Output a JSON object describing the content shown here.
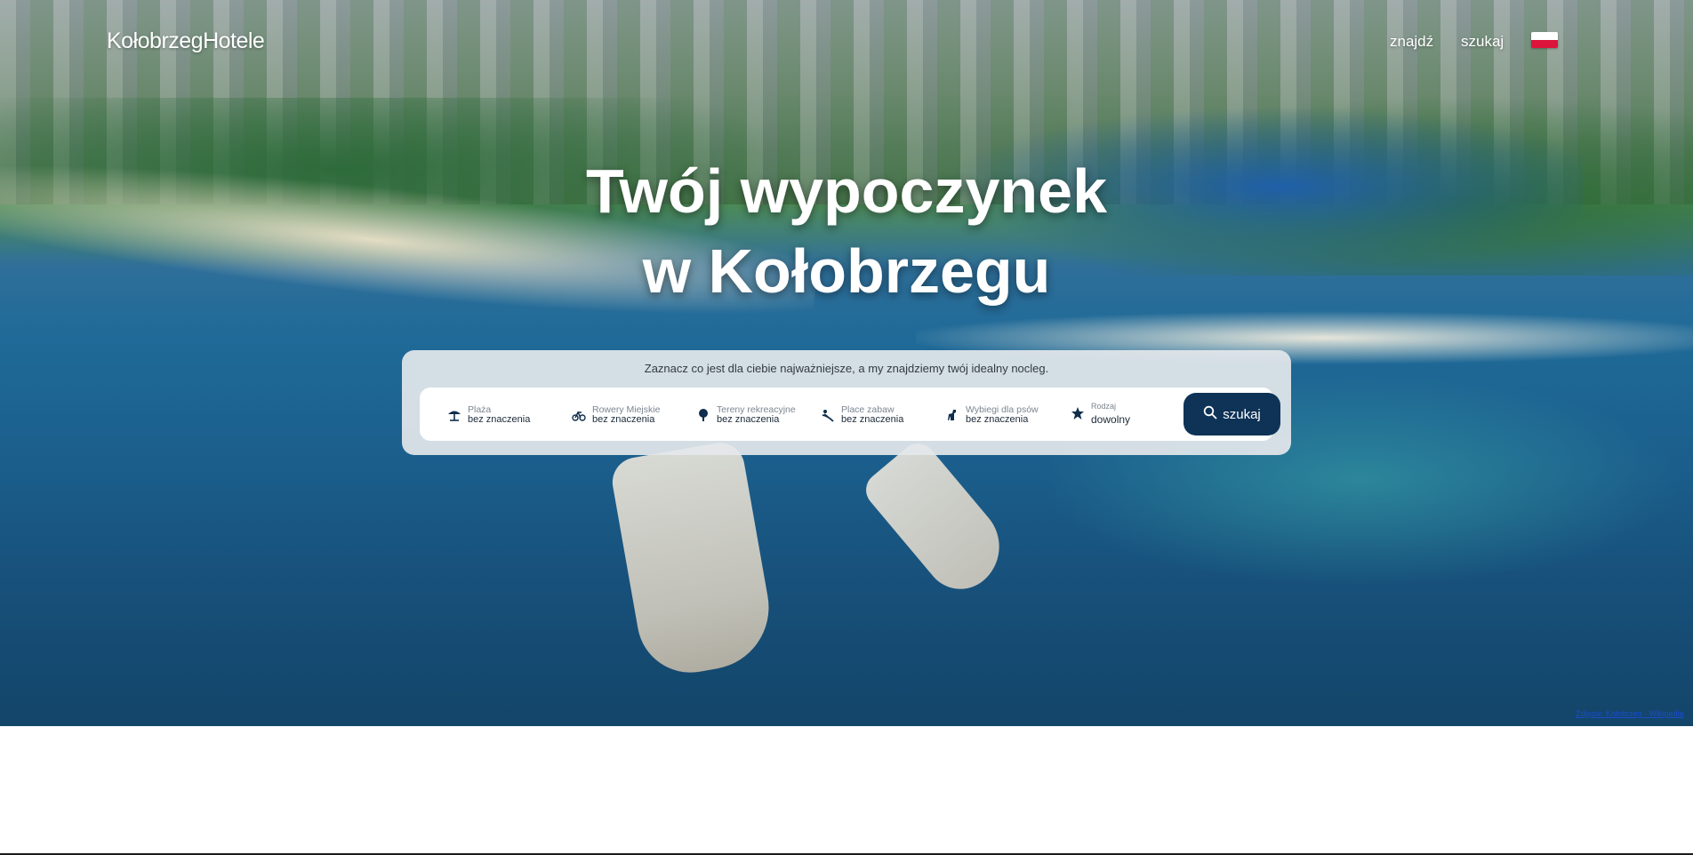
{
  "header": {
    "logo": "KołobrzegHotele",
    "nav": [
      {
        "label": "znajdź"
      },
      {
        "label": "szukaj"
      }
    ],
    "language_flag": "flag-poland-icon"
  },
  "hero": {
    "headline_line1": "Twój wypoczynek",
    "headline_line2": "w Kołobrzegu",
    "photo_attribution": "Zdjęcie: Kołobrzeg - Wikipedia"
  },
  "search": {
    "hint": "Zaznacz co jest dla ciebie najważniejsze, a my znajdziemy twój idealny nocleg.",
    "filters": [
      {
        "icon": "beach-umbrella-icon",
        "label": "Plaża",
        "value": "bez znaczenia"
      },
      {
        "icon": "bicycle-icon",
        "label": "Rowery Miejskie",
        "value": "bez znaczenia"
      },
      {
        "icon": "tree-icon",
        "label": "Tereny rekreacyjne",
        "value": "bez znaczenia"
      },
      {
        "icon": "playground-slide-icon",
        "label": "Place zabaw",
        "value": "bez znaczenia"
      },
      {
        "icon": "dog-icon",
        "label": "Wybiegi dla psów",
        "value": "bez znaczenia"
      },
      {
        "icon": "star-icon",
        "label": "Rodzaj",
        "value": "dowolny"
      }
    ],
    "button_label": "szukaj",
    "button_icon": "search-icon"
  },
  "colors": {
    "primary": "#0e3357",
    "hint_text": "#333a42",
    "flag_red": "#dc143c"
  }
}
